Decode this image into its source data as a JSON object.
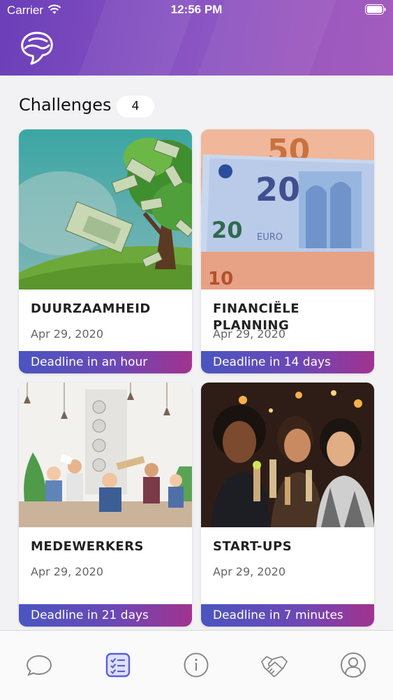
{
  "status_bar": {
    "carrier": "Carrier",
    "time": "12:56 PM"
  },
  "section": {
    "title": "Challenges",
    "count": "4"
  },
  "challenges": [
    {
      "title": "DUURZAAMHEID",
      "date": "Apr 29, 2020",
      "deadline": "Deadline in an hour"
    },
    {
      "title": "FINANCIËLE PLANNING",
      "date": "Apr 29, 2020",
      "deadline": "Deadline in 14 days"
    },
    {
      "title": "MEDEWERKERS",
      "date": "Apr 29, 2020",
      "deadline": "Deadline in 21 days"
    },
    {
      "title": "START-UPS",
      "date": "Apr 29, 2020",
      "deadline": "Deadline in 7 minutes"
    }
  ],
  "tabs": [
    {
      "icon": "chat-bubble-icon",
      "active": false
    },
    {
      "icon": "checklist-icon",
      "active": true
    },
    {
      "icon": "info-icon",
      "active": false
    },
    {
      "icon": "handshake-icon",
      "active": false
    },
    {
      "icon": "profile-icon",
      "active": false
    }
  ],
  "colors": {
    "accent": "#5a5fdc",
    "header_gradient_start": "#6a3fb8",
    "header_gradient_end": "#a35cbd",
    "deadline_gradient_start": "#4a55c0",
    "deadline_gradient_end": "#a1338f"
  }
}
